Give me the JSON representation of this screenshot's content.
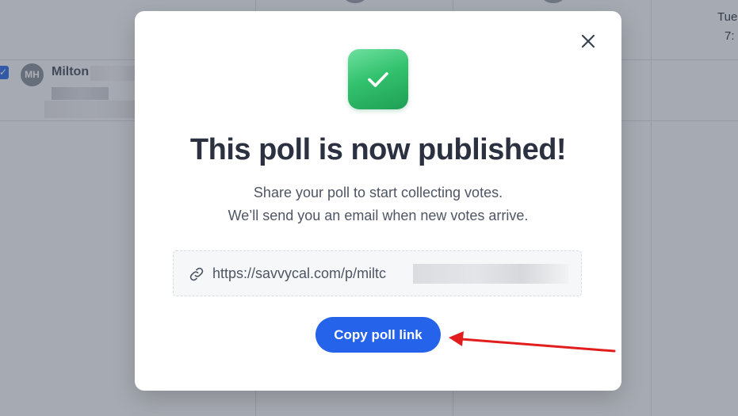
{
  "background": {
    "day_label": "Tue",
    "time_label": "7:",
    "user_initials": "MH",
    "user_name": "Milton"
  },
  "modal": {
    "title": "This poll is now published!",
    "description_line1": "Share your poll to start collecting votes.",
    "description_line2": "We’ll send you an email when new votes arrive.",
    "poll_link_visible": "https://savvycal.com/p/miltc",
    "copy_button_label": "Copy poll link",
    "close_icon": "close-icon",
    "success_icon": "checkmark-icon",
    "link_icon": "link-icon"
  },
  "colors": {
    "primary_button": "#2563eb",
    "success_badge": "#2fbf6a",
    "annotation_arrow": "#e11d1d",
    "title_text": "#2b3140"
  }
}
